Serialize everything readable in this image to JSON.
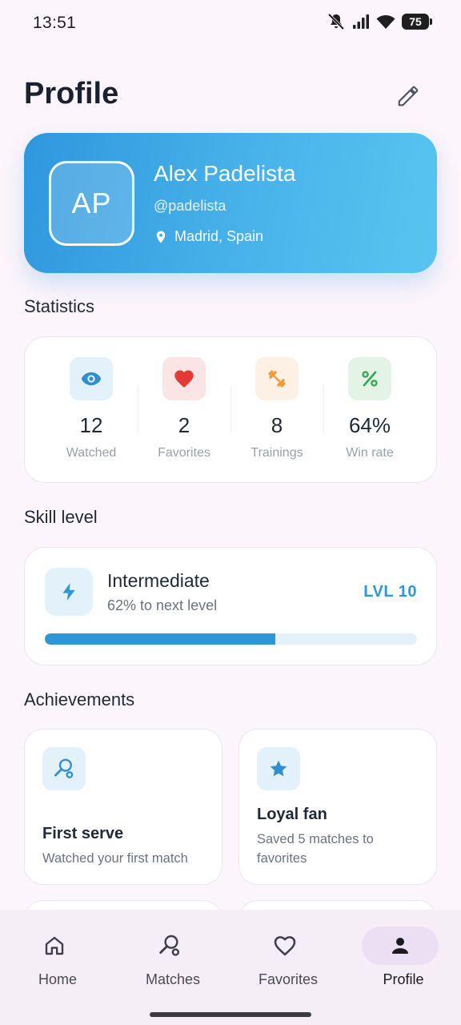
{
  "status_bar": {
    "time": "13:51",
    "battery": "75"
  },
  "header": {
    "title": "Profile"
  },
  "profile": {
    "initials": "AP",
    "name": "Alex Padelista",
    "handle": "@padelista",
    "location": "Madrid, Spain",
    "gradient_start": "#2f97dd",
    "gradient_end": "#58c5f0"
  },
  "statistics": {
    "title": "Statistics",
    "items": [
      {
        "icon": "eye-icon",
        "value": "12",
        "label": "Watched",
        "icon_bg": "#e3f1fb",
        "icon_color": "#2f8fcf"
      },
      {
        "icon": "heart-icon",
        "value": "2",
        "label": "Favorites",
        "icon_bg": "#fbe4e4",
        "icon_color": "#e53935"
      },
      {
        "icon": "dumbbell-icon",
        "value": "8",
        "label": "Trainings",
        "icon_bg": "#fdf0e4",
        "icon_color": "#ef9a3c"
      },
      {
        "icon": "percent-icon",
        "value": "64%",
        "label": "Win rate",
        "icon_bg": "#e3f4e6",
        "icon_color": "#3aa55a"
      }
    ]
  },
  "skill": {
    "title": "Skill level",
    "level_name": "Intermediate",
    "progress_text": "62% to next level",
    "progress_fraction": 0.62,
    "level_badge": "LVL 10",
    "icon": "bolt-icon"
  },
  "achievements": {
    "title": "Achievements",
    "items": [
      {
        "icon": "racket-icon",
        "title": "First serve",
        "description": "Watched your first match"
      },
      {
        "icon": "star-icon",
        "title": "Loyal fan",
        "description": "Saved 5 matches to favorites"
      }
    ]
  },
  "bottom_nav": {
    "items": [
      {
        "label": "Home",
        "icon": "home-icon",
        "active": false
      },
      {
        "label": "Matches",
        "icon": "racket-icon",
        "active": false
      },
      {
        "label": "Favorites",
        "icon": "heart-outline-icon",
        "active": false
      },
      {
        "label": "Profile",
        "icon": "person-icon",
        "active": true
      }
    ],
    "active_color": "#ebdff3"
  }
}
